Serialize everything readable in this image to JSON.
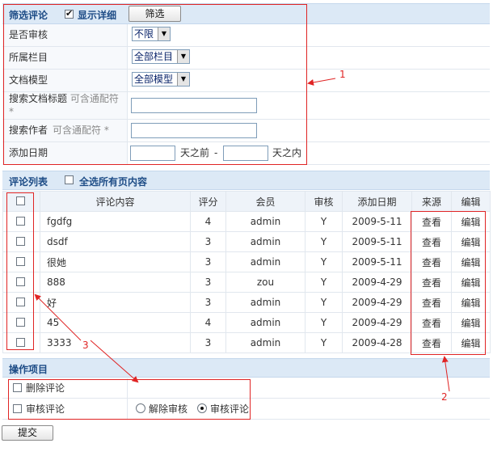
{
  "filter": {
    "title": "筛选评论",
    "show_detail_label": "显示详细",
    "filter_button": "筛选",
    "rows": {
      "audit_label": "是否审核",
      "audit_value": "不限",
      "column_label": "所属栏目",
      "column_value": "全部栏目",
      "model_label": "文档模型",
      "model_value": "全部模型",
      "search_title_label": "搜索文档标题",
      "search_title_hint": "可含通配符 *",
      "search_author_label": "搜索作者",
      "search_author_hint": "可含通配符 *",
      "date_label": "添加日期",
      "days_before": "天之前",
      "dash": "-",
      "days_within": "天之内"
    }
  },
  "list": {
    "title": "评论列表",
    "select_all_label": "全选所有页内容",
    "columns": [
      "评论内容",
      "评分",
      "会员",
      "审核",
      "添加日期",
      "来源",
      "编辑"
    ],
    "rows": [
      {
        "content": "fgdfg",
        "score": "4",
        "member": "admin",
        "audit": "Y",
        "date": "2009-5-11",
        "source": "查看",
        "edit": "编辑"
      },
      {
        "content": "dsdf",
        "score": "3",
        "member": "admin",
        "audit": "Y",
        "date": "2009-5-11",
        "source": "查看",
        "edit": "编辑"
      },
      {
        "content": "很她",
        "score": "3",
        "member": "admin",
        "audit": "Y",
        "date": "2009-5-11",
        "source": "查看",
        "edit": "编辑"
      },
      {
        "content": "888",
        "score": "3",
        "member": "zou",
        "audit": "Y",
        "date": "2009-4-29",
        "source": "查看",
        "edit": "编辑"
      },
      {
        "content": "好",
        "score": "3",
        "member": "admin",
        "audit": "Y",
        "date": "2009-4-29",
        "source": "查看",
        "edit": "编辑"
      },
      {
        "content": "45",
        "score": "4",
        "member": "admin",
        "audit": "Y",
        "date": "2009-4-29",
        "source": "查看",
        "edit": "编辑"
      },
      {
        "content": "3333",
        "score": "3",
        "member": "admin",
        "audit": "Y",
        "date": "2009-4-28",
        "source": "查看",
        "edit": "编辑"
      }
    ]
  },
  "operations": {
    "title": "操作项目",
    "delete_label": "删除评论",
    "audit_label": "审核评论",
    "unaudit_radio": "解除审核",
    "audit_radio": "审核评论"
  },
  "submit_label": "提交",
  "annotations": {
    "n1": "1",
    "n2": "2",
    "n3": "3",
    "color": "#e02424"
  }
}
